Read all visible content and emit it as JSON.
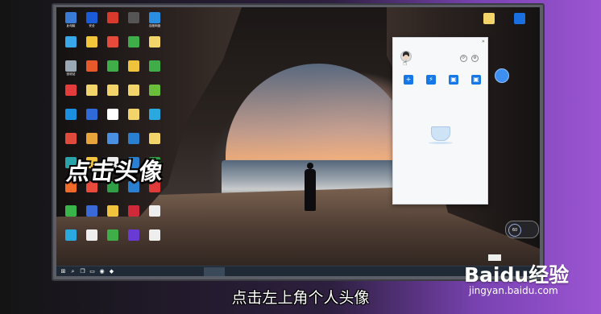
{
  "desktop_icons": [
    {
      "label": "此电脑",
      "color": "#3a7bd5"
    },
    {
      "label": "安全",
      "color": "#1a5bd8"
    },
    {
      "label": "",
      "color": "#d83a2b"
    },
    {
      "label": "",
      "color": "#555"
    },
    {
      "label": "百度网盘",
      "color": "#2a8fe0"
    },
    {
      "label": "",
      "color": "#38a8e8"
    },
    {
      "label": "",
      "color": "#f3c53a"
    },
    {
      "label": "",
      "color": "#e64a3b"
    },
    {
      "label": "",
      "color": "#3fae49"
    },
    {
      "label": "",
      "color": "#f2d46b"
    },
    {
      "label": "回收站",
      "color": "#9aa7b4"
    },
    {
      "label": "",
      "color": "#e8592a"
    },
    {
      "label": "",
      "color": "#3fae49"
    },
    {
      "label": "",
      "color": "#f0c33c"
    },
    {
      "label": "",
      "color": "#3fae49"
    },
    {
      "label": "",
      "color": "#e53b3b"
    },
    {
      "label": "",
      "color": "#f2d46b"
    },
    {
      "label": "",
      "color": "#f2d46b"
    },
    {
      "label": "",
      "color": "#f2d46b"
    },
    {
      "label": "",
      "color": "#6abf3a"
    },
    {
      "label": "",
      "color": "#1a8fe0"
    },
    {
      "label": "",
      "color": "#2f6bd8"
    },
    {
      "label": "",
      "color": "#ffffff"
    },
    {
      "label": "",
      "color": "#f2d46b"
    },
    {
      "label": "",
      "color": "#2aa8e0"
    },
    {
      "label": "",
      "color": "#e04a3a"
    },
    {
      "label": "",
      "color": "#e8a33a"
    },
    {
      "label": "",
      "color": "#4a90e2"
    },
    {
      "label": "",
      "color": "#2a7fd0"
    },
    {
      "label": "",
      "color": "#f2d46b"
    },
    {
      "label": "",
      "color": "#2aa3a8"
    },
    {
      "label": "",
      "color": "#f5c542"
    },
    {
      "label": "",
      "color": "#eeeeee"
    },
    {
      "label": "",
      "color": "#2a7fd0"
    },
    {
      "label": "",
      "color": "#2f9e44"
    },
    {
      "label": "",
      "color": "#f06a2a"
    },
    {
      "label": "",
      "color": "#e84b3c"
    },
    {
      "label": "",
      "color": "#2f9e44"
    },
    {
      "label": "",
      "color": "#2a7fd0"
    },
    {
      "label": "",
      "color": "#e03a3a"
    },
    {
      "label": "",
      "color": "#3ab54a"
    },
    {
      "label": "",
      "color": "#3a6ad5"
    },
    {
      "label": "",
      "color": "#f0c33c"
    },
    {
      "label": "",
      "color": "#d02a3a"
    },
    {
      "label": "",
      "color": "#eeeeee"
    },
    {
      "label": "",
      "color": "#2aa8e0"
    },
    {
      "label": "",
      "color": "#eeeeee"
    },
    {
      "label": "",
      "color": "#3fae49"
    },
    {
      "label": "",
      "color": "#6a3ad5"
    },
    {
      "label": "",
      "color": "#eeeeee"
    }
  ],
  "right_icons": [
    {
      "label": "",
      "color": "#f2d46b"
    },
    {
      "label": "",
      "color": "#1a6fe0"
    }
  ],
  "panel": {
    "title": "",
    "username": "",
    "tiles": [
      {
        "icon": "+",
        "label": ""
      },
      {
        "icon": "⚡",
        "label": ""
      },
      {
        "icon": "▣",
        "label": ""
      },
      {
        "icon": "▣",
        "label": ""
      }
    ],
    "more_link": "",
    "empty_text": ""
  },
  "side_bubble": "",
  "speed_widget": {
    "value": "60",
    "up": "",
    "down": ""
  },
  "taskbar": {
    "items": [
      "",
      "",
      "",
      ""
    ]
  },
  "wm_tag": "",
  "overlay_caption": "点击头像",
  "subtitle": "点击左上角个人头像",
  "watermark": {
    "brand": "Baidu经验",
    "url": "jingyan.baidu.com"
  }
}
